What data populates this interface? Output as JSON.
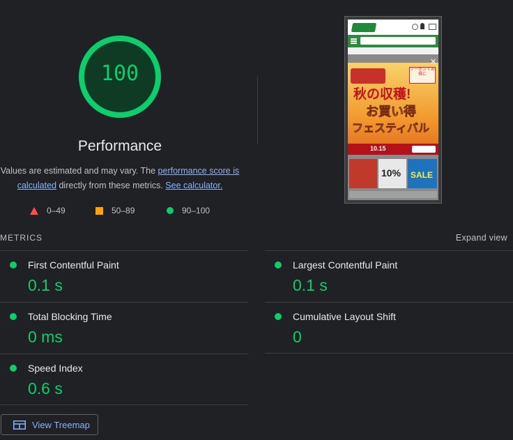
{
  "score": {
    "value": "100",
    "fraction": 1.0,
    "title": "Performance",
    "color": "#0cce6b"
  },
  "description": {
    "prefix": "Values are estimated and may vary. The ",
    "link1": "performance score is calculated",
    "middle": " directly from these metrics. ",
    "link2": "See calculator."
  },
  "legend": [
    {
      "icon": "triangle-icon",
      "range": "0–49",
      "color": "#ff4e42"
    },
    {
      "icon": "square-icon",
      "range": "50–89",
      "color": "#ffa400"
    },
    {
      "icon": "circle-icon",
      "range": "90–100",
      "color": "#0cce6b"
    }
  ],
  "metrics_header": "METRICS",
  "expand_view": "Expand view",
  "metrics": [
    {
      "label": "First Contentful Paint",
      "value": "0.1 s"
    },
    {
      "label": "Largest Contentful Paint",
      "value": "0.1 s"
    },
    {
      "label": "Total Blocking Time",
      "value": "0 ms"
    },
    {
      "label": "Cumulative Layout Shift",
      "value": "0"
    },
    {
      "label": "Speed Index",
      "value": "0.6 s"
    }
  ],
  "treemap_button": "View Treemap",
  "screenshot": {
    "banner_line1": "秋の収穫!",
    "banner_line2": "お買い得",
    "banner_line3": "フェスティバル",
    "coupon": "クーポンでお得に",
    "date": "10.15",
    "sale": "SALE",
    "percent": "10%"
  },
  "colors": {
    "background": "#202124",
    "pass": "#0cce6b",
    "average": "#ffa400",
    "fail": "#ff4e42",
    "link": "#8ab4f8"
  }
}
